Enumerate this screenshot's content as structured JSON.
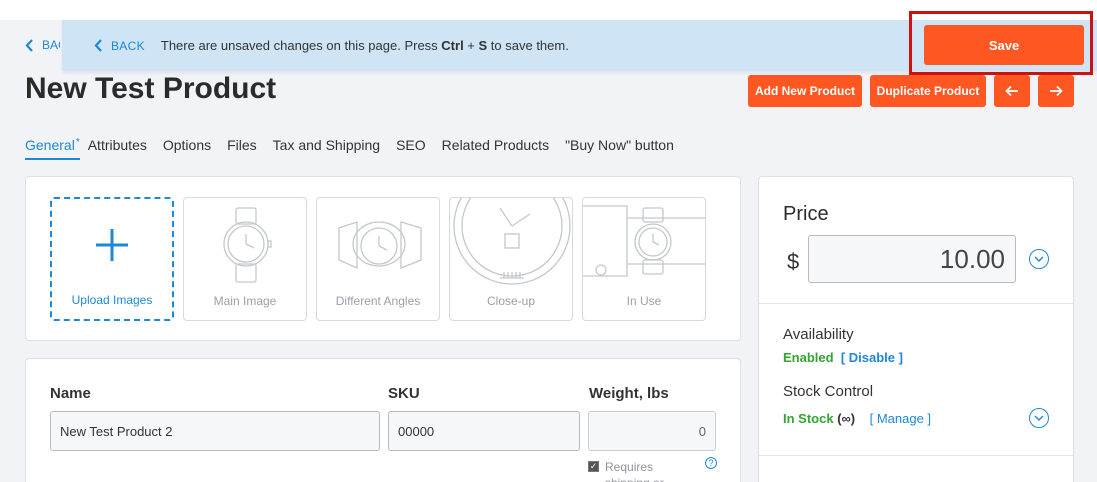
{
  "notice": {
    "back_label": "BACK",
    "back_label_behind": "BACK",
    "message_prefix": "There are unsaved changes on this page. Press ",
    "key_ctrl": "Ctrl",
    "key_plus": " + ",
    "key_s": "S",
    "message_suffix": " to save them.",
    "save_label": "Save"
  },
  "product": {
    "title": "New Test Product"
  },
  "header_buttons": {
    "add_new": "Add New Product",
    "duplicate": "Duplicate Product",
    "prev_icon": "arrow-left-icon",
    "next_icon": "arrow-right-icon"
  },
  "tabs": [
    {
      "label": "General",
      "active": true,
      "modified_mark": "*"
    },
    {
      "label": "Attributes"
    },
    {
      "label": "Options"
    },
    {
      "label": "Files"
    },
    {
      "label": "Tax and Shipping"
    },
    {
      "label": "SEO"
    },
    {
      "label": "Related Products"
    },
    {
      "label": "\"Buy Now\" button"
    }
  ],
  "images": {
    "upload_label": "Upload Images",
    "slots": [
      {
        "label": "Main Image",
        "icon": "watch-icon"
      },
      {
        "label": "Different Angles",
        "icon": "watch-angle-icon"
      },
      {
        "label": "Close-up",
        "icon": "watch-closeup-icon"
      },
      {
        "label": "In Use",
        "icon": "watch-wrist-icon"
      }
    ]
  },
  "fields": {
    "name_label": "Name",
    "name_value": "New Test Product 2",
    "sku_label": "SKU",
    "sku_value": "00000",
    "weight_label": "Weight, lbs",
    "weight_value": "0",
    "requires_shipping": "Requires shipping or",
    "requires_checked": true
  },
  "pricing": {
    "price_label": "Price",
    "currency": "$",
    "price_value": "10.00",
    "availability_label": "Availability",
    "availability_status": "Enabled",
    "availability_action": "[ Disable ]",
    "stock_label": "Stock Control",
    "stock_status": "In Stock",
    "stock_qty": "(∞)",
    "stock_action": "[ Manage ]"
  },
  "colors": {
    "accent": "#ff5722",
    "link": "#1e88d6",
    "success": "#33a532",
    "notice_bg": "#cfe4f5",
    "highlight_border": "#cc1111"
  }
}
